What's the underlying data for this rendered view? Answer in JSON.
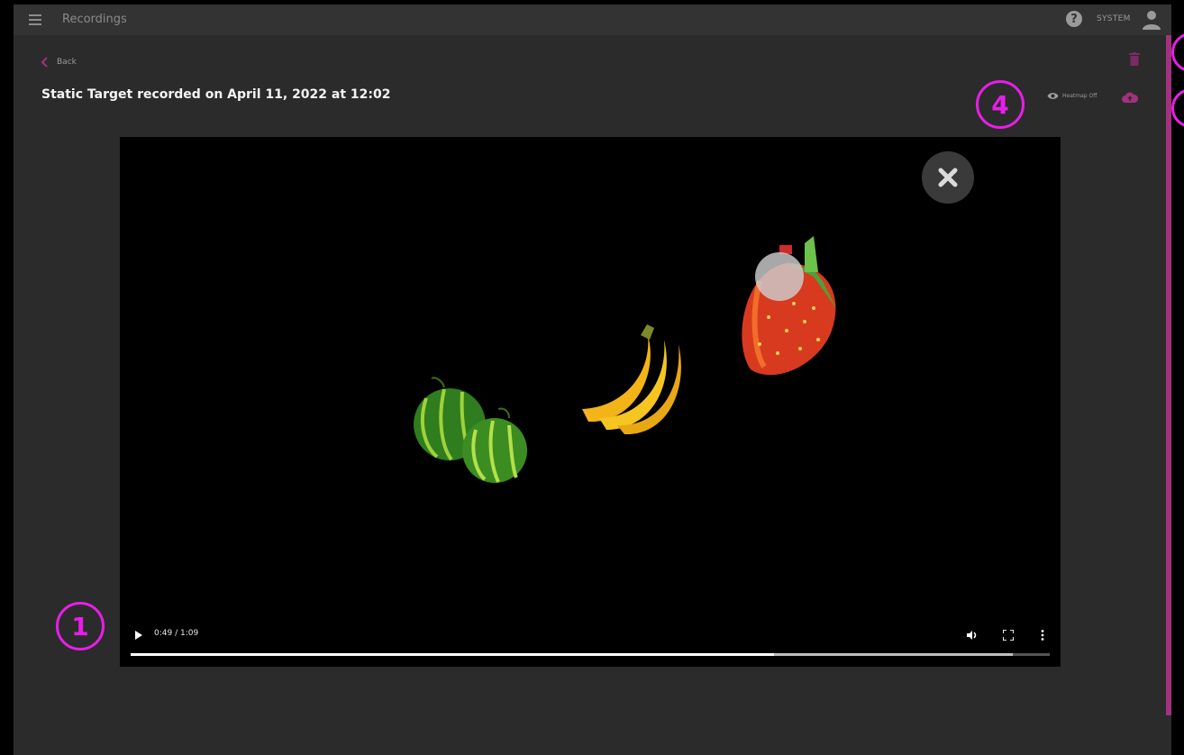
{
  "header": {
    "app_title": "Recordings",
    "user_label": "SYSTEM",
    "help_symbol": "?",
    "icons": [
      "menu-icon",
      "help-icon",
      "user-icon"
    ]
  },
  "page": {
    "back_label": "Back",
    "title": "Static Target recorded on April 11, 2022 at 12:02"
  },
  "actions": {
    "heatmap_label": "Heatmap Off",
    "icons": [
      "trash-icon",
      "eye-icon",
      "cloud-upload-icon"
    ]
  },
  "video": {
    "time_display": "0:49 / 1:09",
    "played_fraction": 0.7,
    "buffered_fraction": 0.96,
    "overlay_icon": "close-icon",
    "content": [
      "watermelon",
      "banana",
      "strawberry"
    ]
  },
  "callouts": {
    "one": "1",
    "four": "4",
    "partial_a": "",
    "partial_b": ""
  },
  "colors": {
    "accent": "#a2317f",
    "callout": "#e81ee8",
    "background": "#2b2b2b",
    "topbar": "#333333"
  }
}
